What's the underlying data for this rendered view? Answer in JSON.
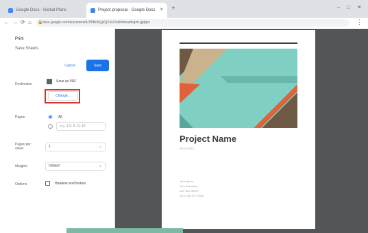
{
  "browser": {
    "tabs": [
      {
        "label": "Google Docs - Global Plans",
        "active": false
      },
      {
        "label": "Project proposal - Google Docs",
        "active": true
      }
    ],
    "new_tab_symbol": "+",
    "close_symbol": "×",
    "window_controls": [
      "–",
      "□",
      "✕"
    ],
    "address": "docs.google.com/document/d/1f9Bn6QpOjYzz2/edit#heading=h.gjdgxs",
    "nav_symbols": [
      "←",
      "→",
      "⟳",
      "⌂"
    ],
    "menu_symbol": "⋮"
  },
  "print_panel": {
    "title": "Print",
    "subtitle": "Save Sheets",
    "cancel_label": "Cancel",
    "save_label": "Save",
    "destination_label": "Destination",
    "destination_value": "Save as PDF",
    "change_label": "Change...",
    "pages_label": "Pages",
    "pages_option_all": "All",
    "pages_input_placeholder": "e.g. 1-5, 8, 11-13",
    "pages_per_sheet_label": "Pages per sheet",
    "pages_per_sheet_value": "1",
    "margins_label": "Margins",
    "margins_value": "Default",
    "options_label": "Options",
    "option_headers": "Headers and footers"
  },
  "preview": {
    "title": "Project Name",
    "subtitle": "09.04.20XX",
    "details": [
      "Your Name",
      "Your Company",
      "123 Your Street",
      "Your City, ST 12345"
    ]
  },
  "colors": {
    "accent": "#1a73e8",
    "highlight": "#d9332b",
    "preview_bg": "#525659",
    "cover_teal": "#7fcfc2",
    "cover_orange": "#e0613a",
    "cover_tan": "#c9b28c",
    "cover_brown": "#6e5a44"
  }
}
